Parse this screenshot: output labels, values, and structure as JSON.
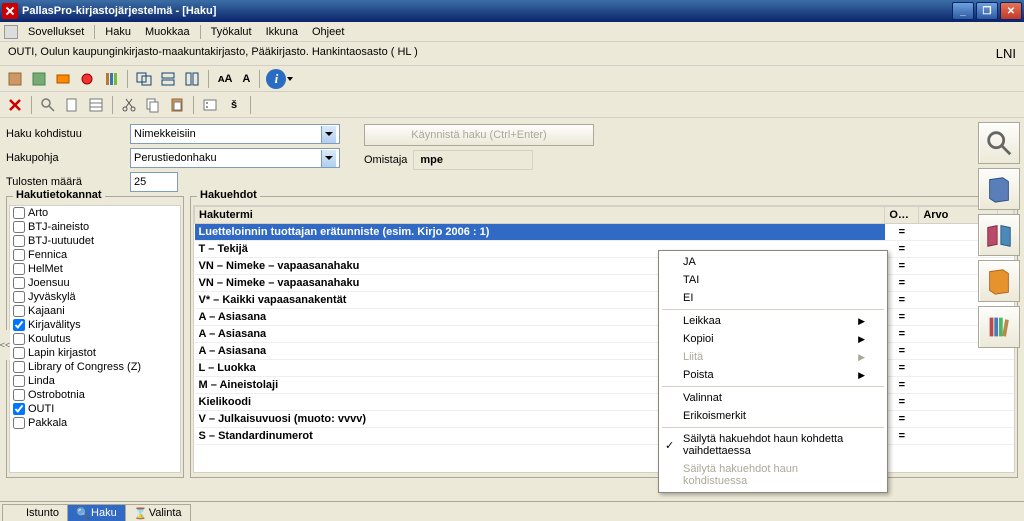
{
  "window": {
    "title": "PallasPro-kirjastojärjestelmä - [Haku]"
  },
  "menubar": [
    "Sovellukset",
    "Haku",
    "Muokkaa",
    "Työkalut",
    "Ikkuna",
    "Ohjeet"
  ],
  "breadcrumb": {
    "path": "OUTI, Oulun kaupunginkirjasto-maakuntakirjasto, Pääkirjasto. Hankintaosasto ( HL )",
    "right": "LNI"
  },
  "form": {
    "target_label": "Haku kohdistuu",
    "target_value": "Nimekkeisiin",
    "template_label": "Hakupohja",
    "template_value": "Perustiedonhaku",
    "count_label": "Tulosten määrä",
    "count_value": "25",
    "run_label": "Käynnistä haku (Ctrl+Enter)",
    "owner_label": "Omistaja",
    "owner_value": "mpe"
  },
  "databases": {
    "legend": "Hakutietokannat",
    "items": [
      {
        "label": "Arto",
        "checked": false
      },
      {
        "label": "BTJ-aineisto",
        "checked": false
      },
      {
        "label": "BTJ-uutuudet",
        "checked": false
      },
      {
        "label": "Fennica",
        "checked": false
      },
      {
        "label": "HelMet",
        "checked": false
      },
      {
        "label": "Joensuu",
        "checked": false
      },
      {
        "label": "Jyväskylä",
        "checked": false
      },
      {
        "label": "Kajaani",
        "checked": false
      },
      {
        "label": "Kirjavälitys",
        "checked": true
      },
      {
        "label": "Koulutus",
        "checked": false
      },
      {
        "label": "Lapin kirjastot",
        "checked": false
      },
      {
        "label": "Library of Congress (Z)",
        "checked": false
      },
      {
        "label": "Linda",
        "checked": false
      },
      {
        "label": "Ostrobotnia",
        "checked": false
      },
      {
        "label": "OUTI",
        "checked": true
      },
      {
        "label": "Pakkala",
        "checked": false
      }
    ]
  },
  "criteria": {
    "legend": "Hakuehdot",
    "headers": {
      "term": "Hakutermi",
      "op": "O…",
      "value": "Arvo"
    },
    "rows": [
      {
        "term": "Luetteloinnin tuottajan erätunniste (esim. Kirjo 2006 : 1)",
        "op": "=",
        "value": "",
        "selected": true
      },
      {
        "term": "T – Tekijä",
        "op": "=",
        "value": ""
      },
      {
        "term": "VN – Nimeke – vapaasanahaku",
        "op": "=",
        "value": ""
      },
      {
        "term": "VN – Nimeke – vapaasanahaku",
        "op": "=",
        "value": ""
      },
      {
        "term": "V* – Kaikki vapaasanakentät",
        "op": "=",
        "value": ""
      },
      {
        "term": "A – Asiasana",
        "op": "=",
        "value": ""
      },
      {
        "term": "A – Asiasana",
        "op": "=",
        "value": ""
      },
      {
        "term": "    A – Asiasana",
        "op": "=",
        "value": ""
      },
      {
        "term": "L – Luokka",
        "op": "=",
        "value": ""
      },
      {
        "term": "M – Aineistolaji",
        "op": "=",
        "value": ""
      },
      {
        "term": "Kielikoodi",
        "op": "=",
        "value": ""
      },
      {
        "term": "V – Julkaisuvuosi (muoto: vvvv)",
        "op": "=",
        "value": ""
      },
      {
        "term": "S – Standardinumerot",
        "op": "=",
        "value": ""
      }
    ]
  },
  "context_menu": {
    "ja": "JA",
    "tai": "TAI",
    "ei": "EI",
    "cut": "Leikkaa",
    "copy": "Kopioi",
    "paste": "Liitä",
    "delete": "Poista",
    "valinnat": "Valinnat",
    "erikois": "Erikoismerkit",
    "keep1": "Säilytä hakuehdot haun kohdetta vaihdettaessa",
    "keep2": "Säilytä hakuehdot haun kohdistuessa"
  },
  "bottom_tabs": {
    "istunto": "Istunto",
    "haku": "Haku",
    "valinta": "Valinta"
  },
  "icons": {
    "info": "i"
  }
}
